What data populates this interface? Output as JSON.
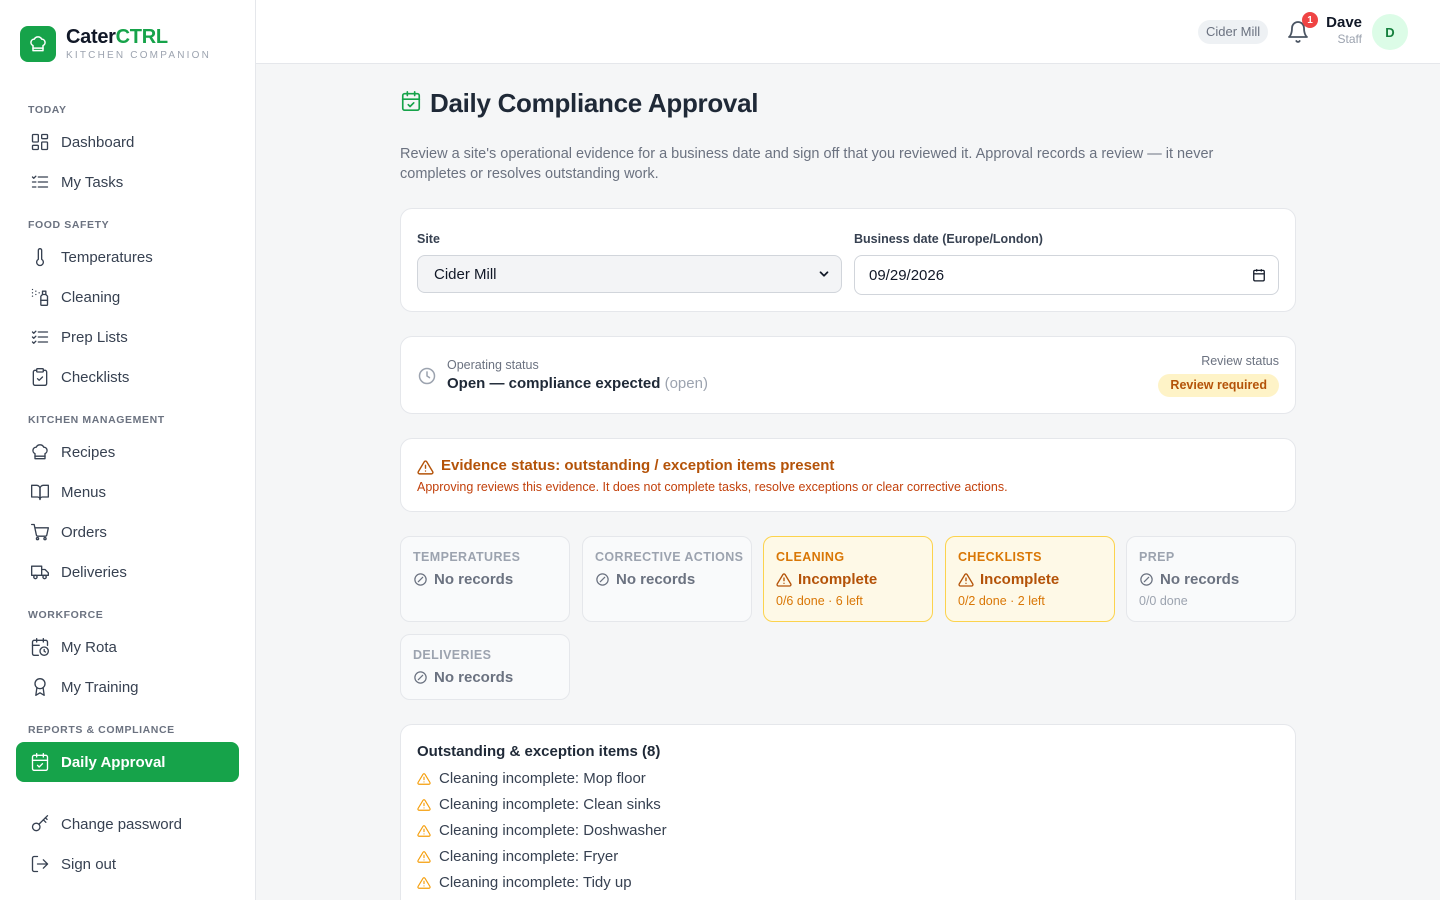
{
  "brand": {
    "name_main": "Cater",
    "name_accent": "CTRL",
    "subtitle": "KITCHEN COMPANION"
  },
  "sidebar": {
    "sections": [
      {
        "label": "TODAY"
      },
      {
        "label": "FOOD SAFETY"
      },
      {
        "label": "KITCHEN MANAGEMENT"
      },
      {
        "label": "WORKFORCE"
      },
      {
        "label": "REPORTS & COMPLIANCE"
      }
    ],
    "items": [
      {
        "label": "Dashboard",
        "icon": "dashboard-icon"
      },
      {
        "label": "My Tasks",
        "icon": "tasks-icon"
      },
      {
        "label": "Temperatures",
        "icon": "thermometer-icon"
      },
      {
        "label": "Cleaning",
        "icon": "spray-icon"
      },
      {
        "label": "Prep Lists",
        "icon": "list-check-icon"
      },
      {
        "label": "Checklists",
        "icon": "clipboard-check-icon"
      },
      {
        "label": "Recipes",
        "icon": "chef-hat-icon"
      },
      {
        "label": "Menus",
        "icon": "book-icon"
      },
      {
        "label": "Orders",
        "icon": "cart-icon"
      },
      {
        "label": "Deliveries",
        "icon": "truck-icon"
      },
      {
        "label": "My Rota",
        "icon": "calendar-clock-icon"
      },
      {
        "label": "My Training",
        "icon": "award-icon"
      },
      {
        "label": "Daily Approval",
        "icon": "calendar-check-icon",
        "active": true
      },
      {
        "label": "Change password",
        "icon": "key-icon"
      },
      {
        "label": "Sign out",
        "icon": "sign-out-icon"
      }
    ]
  },
  "topbar": {
    "site": "Cider Mill",
    "notifications": "1",
    "user_name": "Dave",
    "user_role": "Staff",
    "avatar_initial": "D"
  },
  "page": {
    "title": "Daily Compliance Approval",
    "description": "Review a site's operational evidence for a business date and sign off that you reviewed it. Approval records a review — it never completes or resolves outstanding work."
  },
  "form": {
    "site_label": "Site",
    "site_value": "Cider Mill",
    "date_label": "Business date (Europe/London)",
    "date_value": "09/29/2026"
  },
  "status": {
    "operating_label": "Operating status",
    "operating_value": "Open — compliance expected",
    "operating_code": "(open)",
    "review_label": "Review status",
    "review_badge": "Review required"
  },
  "evidence": {
    "title": "Evidence status: outstanding / exception items present",
    "subtitle": "Approving reviews this evidence. It does not complete tasks, resolve exceptions or clear corrective actions."
  },
  "tiles": [
    {
      "label": "TEMPERATURES",
      "status": "No records",
      "sub": "",
      "warn": false
    },
    {
      "label": "CORRECTIVE ACTIONS",
      "status": "No records",
      "sub": "",
      "warn": false
    },
    {
      "label": "CLEANING",
      "status": "Incomplete",
      "sub": "0/6 done · 6 left",
      "warn": true
    },
    {
      "label": "CHECKLISTS",
      "status": "Incomplete",
      "sub": "0/2 done · 2 left",
      "warn": true
    },
    {
      "label": "PREP",
      "status": "No records",
      "sub": "0/0 done",
      "warn": false
    },
    {
      "label": "DELIVERIES",
      "status": "No records",
      "sub": "",
      "warn": false
    }
  ],
  "outstanding": {
    "title": "Outstanding & exception items (8)",
    "items": [
      "Cleaning incomplete: Mop floor",
      "Cleaning incomplete: Clean sinks",
      "Cleaning incomplete: Doshwasher",
      "Cleaning incomplete: Fryer",
      "Cleaning incomplete: Tidy up"
    ]
  },
  "colors": {
    "accent": "#16a34a",
    "warning": "#b45309",
    "warning_bg": "#fef9e7"
  }
}
